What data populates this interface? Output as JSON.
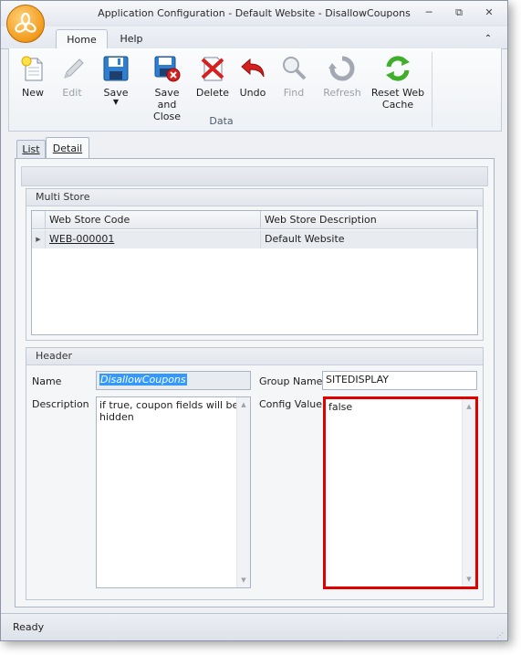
{
  "window": {
    "title": "Application Configuration - Default Website - DisallowCoupons"
  },
  "ribbon_tabs": [
    "Home",
    "Help"
  ],
  "ribbon": {
    "buttons": {
      "new": "New",
      "edit": "Edit",
      "save": "Save",
      "save_close_1": "Save and",
      "save_close_2": "Close",
      "delete": "Delete",
      "undo": "Undo",
      "find": "Find",
      "refresh": "Refresh",
      "reset_1": "Reset Web",
      "reset_2": "Cache"
    },
    "group_label": "Data"
  },
  "page_tabs": [
    "List",
    "Detail"
  ],
  "multi_store": {
    "title": "Multi Store",
    "columns": [
      "Web Store Code",
      "Web Store Description"
    ],
    "rows": [
      {
        "code": "WEB-000001",
        "description": "Default Website"
      }
    ]
  },
  "header": {
    "title": "Header",
    "name_label": "Name",
    "name_value": "DisallowCoupons",
    "group_name_label": "Group Name",
    "group_name_value": "SITEDISPLAY",
    "description_label": "Description",
    "description_line1": "if true, coupon fields will be",
    "description_line2": "hidden",
    "config_value_label": "Config Value",
    "config_value": "false"
  },
  "status": {
    "text": "Ready"
  },
  "colors": {
    "highlight_border": "#e00000",
    "selection": "#3399ff",
    "link": "#1a1a1a"
  }
}
